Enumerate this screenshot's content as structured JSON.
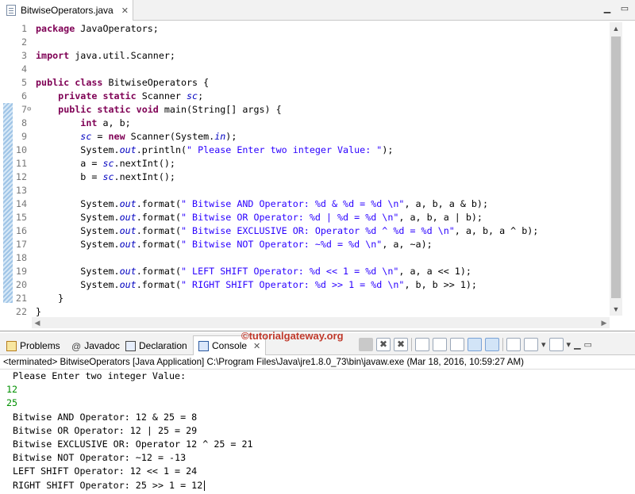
{
  "editor": {
    "tab_title": "BitwiseOperators.java",
    "tab_close": "✕",
    "lines": [
      {
        "n": "1",
        "t": [
          {
            "c": "kw",
            "s": "package"
          },
          {
            "c": "plain",
            "s": " JavaOperators;"
          }
        ]
      },
      {
        "n": "2",
        "t": []
      },
      {
        "n": "3",
        "t": [
          {
            "c": "kw",
            "s": "import"
          },
          {
            "c": "plain",
            "s": " java.util.Scanner;"
          }
        ]
      },
      {
        "n": "4",
        "t": []
      },
      {
        "n": "5",
        "t": [
          {
            "c": "kw",
            "s": "public class"
          },
          {
            "c": "plain",
            "s": " BitwiseOperators {"
          }
        ]
      },
      {
        "n": "6",
        "t": [
          {
            "c": "plain",
            "s": "    "
          },
          {
            "c": "kw",
            "s": "private static"
          },
          {
            "c": "plain",
            "s": " Scanner "
          },
          {
            "c": "fld",
            "s": "sc"
          },
          {
            "c": "plain",
            "s": ";"
          }
        ]
      },
      {
        "n": "7",
        "fold": "⊖",
        "t": [
          {
            "c": "plain",
            "s": "    "
          },
          {
            "c": "kw",
            "s": "public static void"
          },
          {
            "c": "plain",
            "s": " main(String[] args) {"
          }
        ]
      },
      {
        "n": "8",
        "t": [
          {
            "c": "plain",
            "s": "        "
          },
          {
            "c": "kw",
            "s": "int"
          },
          {
            "c": "plain",
            "s": " a, b;"
          }
        ]
      },
      {
        "n": "9",
        "t": [
          {
            "c": "plain",
            "s": "        "
          },
          {
            "c": "fld",
            "s": "sc"
          },
          {
            "c": "plain",
            "s": " = "
          },
          {
            "c": "kw",
            "s": "new"
          },
          {
            "c": "plain",
            "s": " Scanner(System."
          },
          {
            "c": "ifld",
            "s": "in"
          },
          {
            "c": "plain",
            "s": ");"
          }
        ]
      },
      {
        "n": "10",
        "t": [
          {
            "c": "plain",
            "s": "        System."
          },
          {
            "c": "ifld",
            "s": "out"
          },
          {
            "c": "plain",
            "s": ".println("
          },
          {
            "c": "str",
            "s": "\" Please Enter two integer Value: \""
          },
          {
            "c": "plain",
            "s": ");"
          }
        ]
      },
      {
        "n": "11",
        "t": [
          {
            "c": "plain",
            "s": "        a = "
          },
          {
            "c": "fld",
            "s": "sc"
          },
          {
            "c": "plain",
            "s": ".nextInt();"
          }
        ]
      },
      {
        "n": "12",
        "t": [
          {
            "c": "plain",
            "s": "        b = "
          },
          {
            "c": "fld",
            "s": "sc"
          },
          {
            "c": "plain",
            "s": ".nextInt();"
          }
        ]
      },
      {
        "n": "13",
        "t": []
      },
      {
        "n": "14",
        "t": [
          {
            "c": "plain",
            "s": "        System."
          },
          {
            "c": "ifld",
            "s": "out"
          },
          {
            "c": "plain",
            "s": ".format("
          },
          {
            "c": "str",
            "s": "\" Bitwise AND Operator: %d & %d = %d \\n\""
          },
          {
            "c": "plain",
            "s": ", a, b, a & b);"
          }
        ]
      },
      {
        "n": "15",
        "t": [
          {
            "c": "plain",
            "s": "        System."
          },
          {
            "c": "ifld",
            "s": "out"
          },
          {
            "c": "plain",
            "s": ".format("
          },
          {
            "c": "str",
            "s": "\" Bitwise OR Operator: %d | %d = %d \\n\""
          },
          {
            "c": "plain",
            "s": ", a, b, a | b);"
          }
        ]
      },
      {
        "n": "16",
        "t": [
          {
            "c": "plain",
            "s": "        System."
          },
          {
            "c": "ifld",
            "s": "out"
          },
          {
            "c": "plain",
            "s": ".format("
          },
          {
            "c": "str",
            "s": "\" Bitwise EXCLUSIVE OR: Operator %d ^ %d = %d \\n\""
          },
          {
            "c": "plain",
            "s": ", a, b, a ^ b);"
          }
        ]
      },
      {
        "n": "17",
        "t": [
          {
            "c": "plain",
            "s": "        System."
          },
          {
            "c": "ifld",
            "s": "out"
          },
          {
            "c": "plain",
            "s": ".format("
          },
          {
            "c": "str",
            "s": "\" Bitwise NOT Operator: ~%d = %d \\n\""
          },
          {
            "c": "plain",
            "s": ", a, ~a);"
          }
        ]
      },
      {
        "n": "18",
        "t": []
      },
      {
        "n": "19",
        "t": [
          {
            "c": "plain",
            "s": "        System."
          },
          {
            "c": "ifld",
            "s": "out"
          },
          {
            "c": "plain",
            "s": ".format("
          },
          {
            "c": "str",
            "s": "\" LEFT SHIFT Operator: %d << 1 = %d \\n\""
          },
          {
            "c": "plain",
            "s": ", a, a << 1);"
          }
        ]
      },
      {
        "n": "20",
        "t": [
          {
            "c": "plain",
            "s": "        System."
          },
          {
            "c": "ifld",
            "s": "out"
          },
          {
            "c": "plain",
            "s": ".format("
          },
          {
            "c": "str",
            "s": "\" RIGHT SHIFT Operator: %d >> 1 = %d \\n\""
          },
          {
            "c": "plain",
            "s": ", b, b >> 1);"
          }
        ]
      },
      {
        "n": "21",
        "t": [
          {
            "c": "plain",
            "s": "    }"
          }
        ]
      },
      {
        "n": "22",
        "t": [
          {
            "c": "plain",
            "s": "}"
          }
        ]
      }
    ]
  },
  "views": {
    "watermark": "©tutorialgateway.org",
    "tabs": {
      "problems": "Problems",
      "javadoc": "Javadoc",
      "declaration": "Declaration",
      "console": "Console"
    },
    "console_close": "✕"
  },
  "console": {
    "terminated": "<terminated> BitwiseOperators [Java Application] C:\\Program Files\\Java\\jre1.8.0_73\\bin\\javaw.exe (Mar 18, 2016, 10:59:27 AM)",
    "output": [
      {
        "type": "out",
        "text": "Please Enter two integer Value:"
      },
      {
        "type": "in",
        "text": "12"
      },
      {
        "type": "in",
        "text": "25"
      },
      {
        "type": "out",
        "text": "Bitwise AND Operator: 12 & 25 = 8"
      },
      {
        "type": "out",
        "text": "Bitwise OR Operator: 12 | 25 = 29"
      },
      {
        "type": "out",
        "text": "Bitwise EXCLUSIVE OR: Operator 12 ^ 25 = 21"
      },
      {
        "type": "out",
        "text": "Bitwise NOT Operator: ~12 = -13"
      },
      {
        "type": "out",
        "text": "LEFT SHIFT Operator: 12 << 1 = 24"
      },
      {
        "type": "out",
        "text": "RIGHT SHIFT Operator: 25 >> 1 = 12"
      }
    ]
  },
  "colors": {
    "keyword": "#7f0055",
    "field": "#0000c0",
    "string": "#2a00ff",
    "user_input": "#009000",
    "watermark": "#c0392b"
  }
}
